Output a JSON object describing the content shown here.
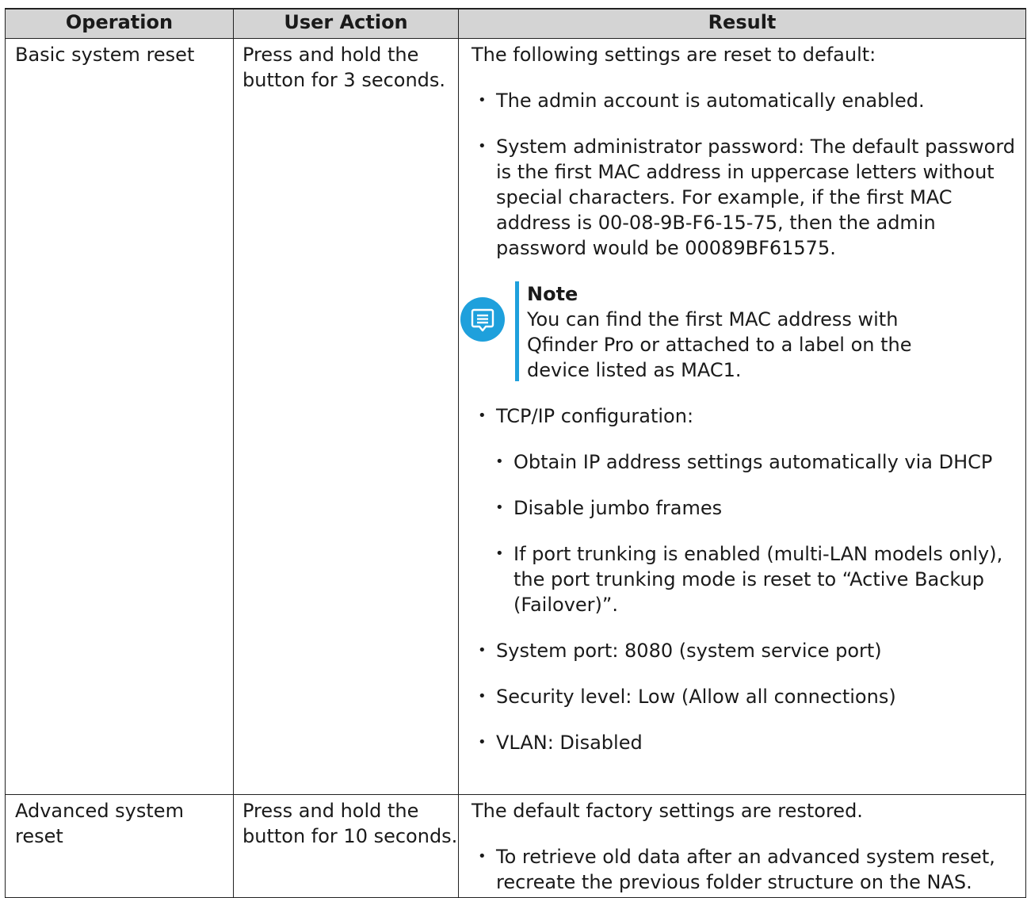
{
  "table": {
    "headers": [
      "Operation",
      "User Action",
      "Result"
    ],
    "rows": [
      {
        "operation": "Basic system reset",
        "action": "Press and hold the button for 3 seconds.",
        "result_intro": "The following settings are reset to default:",
        "bullets": [
          "The admin account is automatically enabled.",
          "System administrator password: The default password is the first MAC address in uppercase letters without special characters. For example, if the first MAC address is 00-08-9B-F6-15-75, then the admin password would be 00089BF61575."
        ],
        "note": {
          "title": "Note",
          "body": "You can find the first MAC address with Qfinder Pro or attached to a label on the device listed as MAC1.",
          "icon": "note-icon",
          "accent_color": "#1ea0dc"
        },
        "tcpip": {
          "label": "TCP/IP configuration:",
          "sub_bullets": [
            "Obtain IP address settings automatically via DHCP",
            "Disable jumbo frames",
            "If port trunking is enabled (multi-LAN models only), the port trunking mode is reset to “Active Backup (Failover)”."
          ]
        },
        "bullets_after": [
          "System port: 8080 (system service port)",
          "Security level: Low (Allow all connections)",
          "VLAN: Disabled"
        ]
      },
      {
        "operation": "Advanced system reset",
        "action": "Press and hold the button for 10 seconds.",
        "result_intro": "The default factory settings are restored.",
        "bullets": [
          "To retrieve old data after an advanced system reset, recreate the previous folder structure on the NAS."
        ]
      }
    ]
  }
}
